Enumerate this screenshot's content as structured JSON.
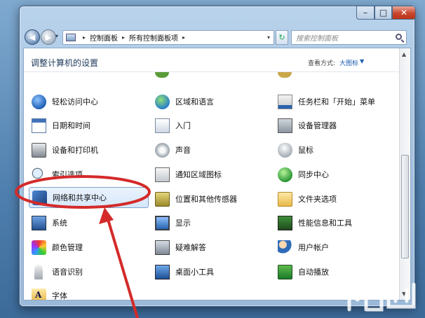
{
  "window": {
    "minimize_symbol": "–",
    "maximize_symbol": "□",
    "close_symbol": "✕"
  },
  "navbar": {
    "back_icon": "◀",
    "forward_icon": "▶",
    "dropdown_icon": "▾",
    "breadcrumb": [
      "控制面板",
      "所有控制面板项"
    ],
    "breadcrumb_separator": "▸",
    "refresh_icon": "↻",
    "search_placeholder": "搜索控制面板"
  },
  "content": {
    "title": "调整计算机的设置",
    "view_label": "查看方式:",
    "view_value": "大图标",
    "view_caret": "▼",
    "scroll_up": "▲",
    "scroll_down": "▼"
  },
  "items": {
    "ease_of_access": "轻松访问中心",
    "region_language": "区域和语言",
    "taskbar_start": "任务栏和「开始」菜单",
    "date_time": "日期和时间",
    "getting_started": "入门",
    "device_manager": "设备管理器",
    "devices_printers": "设备和打印机",
    "sound": "声音",
    "mouse": "鼠标",
    "indexing": "索引选项",
    "notification_icons": "通知区域图标",
    "sync_center": "同步中心",
    "network_sharing": "网络和共享中心",
    "location_sensors": "位置和其他传感器",
    "folder_options": "文件夹选项",
    "system": "系统",
    "display": "显示",
    "performance": "性能信息和工具",
    "color_management": "颜色管理",
    "troubleshooting": "疑难解答",
    "user_accounts": "用户帐户",
    "speech_recognition": "语音识别",
    "desktop_gadgets": "桌面小工具",
    "autoplay": "自动播放",
    "fonts": "字体"
  },
  "colors": {
    "annotation": "#d42a2a",
    "link": "#1c5db0"
  }
}
